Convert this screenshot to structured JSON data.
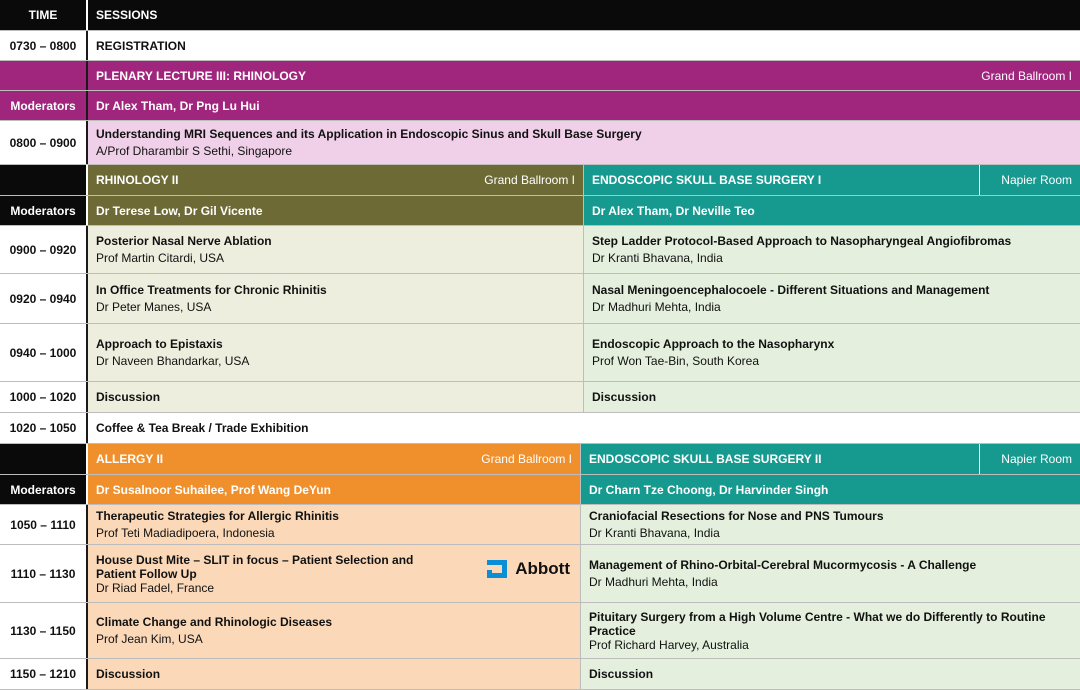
{
  "header": {
    "time": "TIME",
    "sessions": "SESSIONS"
  },
  "registration": {
    "time": "0730 – 0800",
    "title": "REGISTRATION"
  },
  "plenary": {
    "title": "PLENARY LECTURE III: RHINOLOGY",
    "room": "Grand Ballroom I",
    "moderators_label": "Moderators",
    "moderators": "Dr Alex Tham, Dr Png Lu Hui",
    "time": "0800 – 0900",
    "talk": "Understanding MRI Sequences and its Application in Endoscopic Sinus and Skull Base Surgery",
    "speaker": "A/Prof Dharambir S Sethi, Singapore"
  },
  "block1": {
    "left": {
      "title": "RHINOLOGY II",
      "room": "Grand Ballroom I",
      "moderators": "Dr Terese Low, Dr Gil Vicente"
    },
    "right": {
      "title": "ENDOSCOPIC SKULL BASE SURGERY I",
      "room": "Napier Room",
      "moderators": "Dr Alex Tham, Dr Neville Teo"
    },
    "moderators_label": "Moderators",
    "rows": [
      {
        "time": "0900 – 0920",
        "left_title": "Posterior Nasal Nerve Ablation",
        "left_speaker": "Prof Martin Citardi, USA",
        "right_title": "Step Ladder Protocol-Based Approach to Nasopharyngeal Angiofibromas",
        "right_speaker": "Dr Kranti Bhavana, India"
      },
      {
        "time": "0920 – 0940",
        "left_title": "In Office Treatments for Chronic Rhinitis",
        "left_speaker": "Dr Peter Manes, USA",
        "right_title": "Nasal Meningoencephalocoele - Different Situations and Management",
        "right_speaker": "Dr Madhuri Mehta, India"
      },
      {
        "time": "0940 – 1000",
        "left_title": "Approach to Epistaxis",
        "left_speaker": "Dr Naveen Bhandarkar, USA",
        "right_title": "Endoscopic Approach to the Nasopharynx",
        "right_speaker": "Prof Won Tae-Bin, South Korea"
      },
      {
        "time": "1000 – 1020",
        "left_title": "Discussion",
        "right_title": "Discussion"
      }
    ]
  },
  "break": {
    "time": "1020 – 1050",
    "title": "Coffee & Tea Break / Trade Exhibition"
  },
  "block2": {
    "left": {
      "title": "ALLERGY II",
      "room": "Grand Ballroom I",
      "moderators": "Dr Susalnoor Suhailee, Prof Wang DeYun"
    },
    "right": {
      "title": "ENDOSCOPIC SKULL BASE SURGERY II",
      "room": "Napier Room",
      "moderators": "Dr Charn Tze Choong, Dr Harvinder Singh"
    },
    "moderators_label": "Moderators",
    "sponsor": "Abbott",
    "rows": [
      {
        "time": "1050 – 1110",
        "left_title": "Therapeutic Strategies for Allergic Rhinitis",
        "left_speaker": "Prof Teti Madiadipoera, Indonesia",
        "right_title": "Craniofacial Resections for Nose and PNS Tumours",
        "right_speaker": "Dr Kranti Bhavana, India"
      },
      {
        "time": "1110 – 1130",
        "left_title_1": "House Dust Mite – SLIT in focus  – Patient Selection and",
        "left_title_2": "Patient Follow Up",
        "left_speaker": "Dr Riad Fadel, France",
        "right_title": "Management of Rhino-Orbital-Cerebral Mucormycosis - A Challenge",
        "right_speaker": "Dr Madhuri Mehta, India"
      },
      {
        "time": "1130 – 1150",
        "left_title": "Climate Change and Rhinologic Diseases",
        "left_speaker": "Prof Jean Kim, USA",
        "right_title_1": "Pituitary Surgery from a High Volume Centre - What we do Differently to Routine",
        "right_title_2": "Practice",
        "right_speaker": "Prof Richard Harvey, Australia"
      },
      {
        "time": "1150 – 1210",
        "left_title": "Discussion",
        "right_title": "Discussion"
      }
    ]
  },
  "colors": {
    "header": "#0a0a0a",
    "plenary": "#a0257d",
    "plenary_talk": "#f0d0e8",
    "rhinology": "#6d6a36",
    "rhinology_rows": "#eeeede",
    "skull_base": "#16998f",
    "skull_base_rows": "#e4efdd",
    "allergy": "#f0902d",
    "allergy_rows": "#fad8b8",
    "abbott": "#0a8fd6"
  }
}
